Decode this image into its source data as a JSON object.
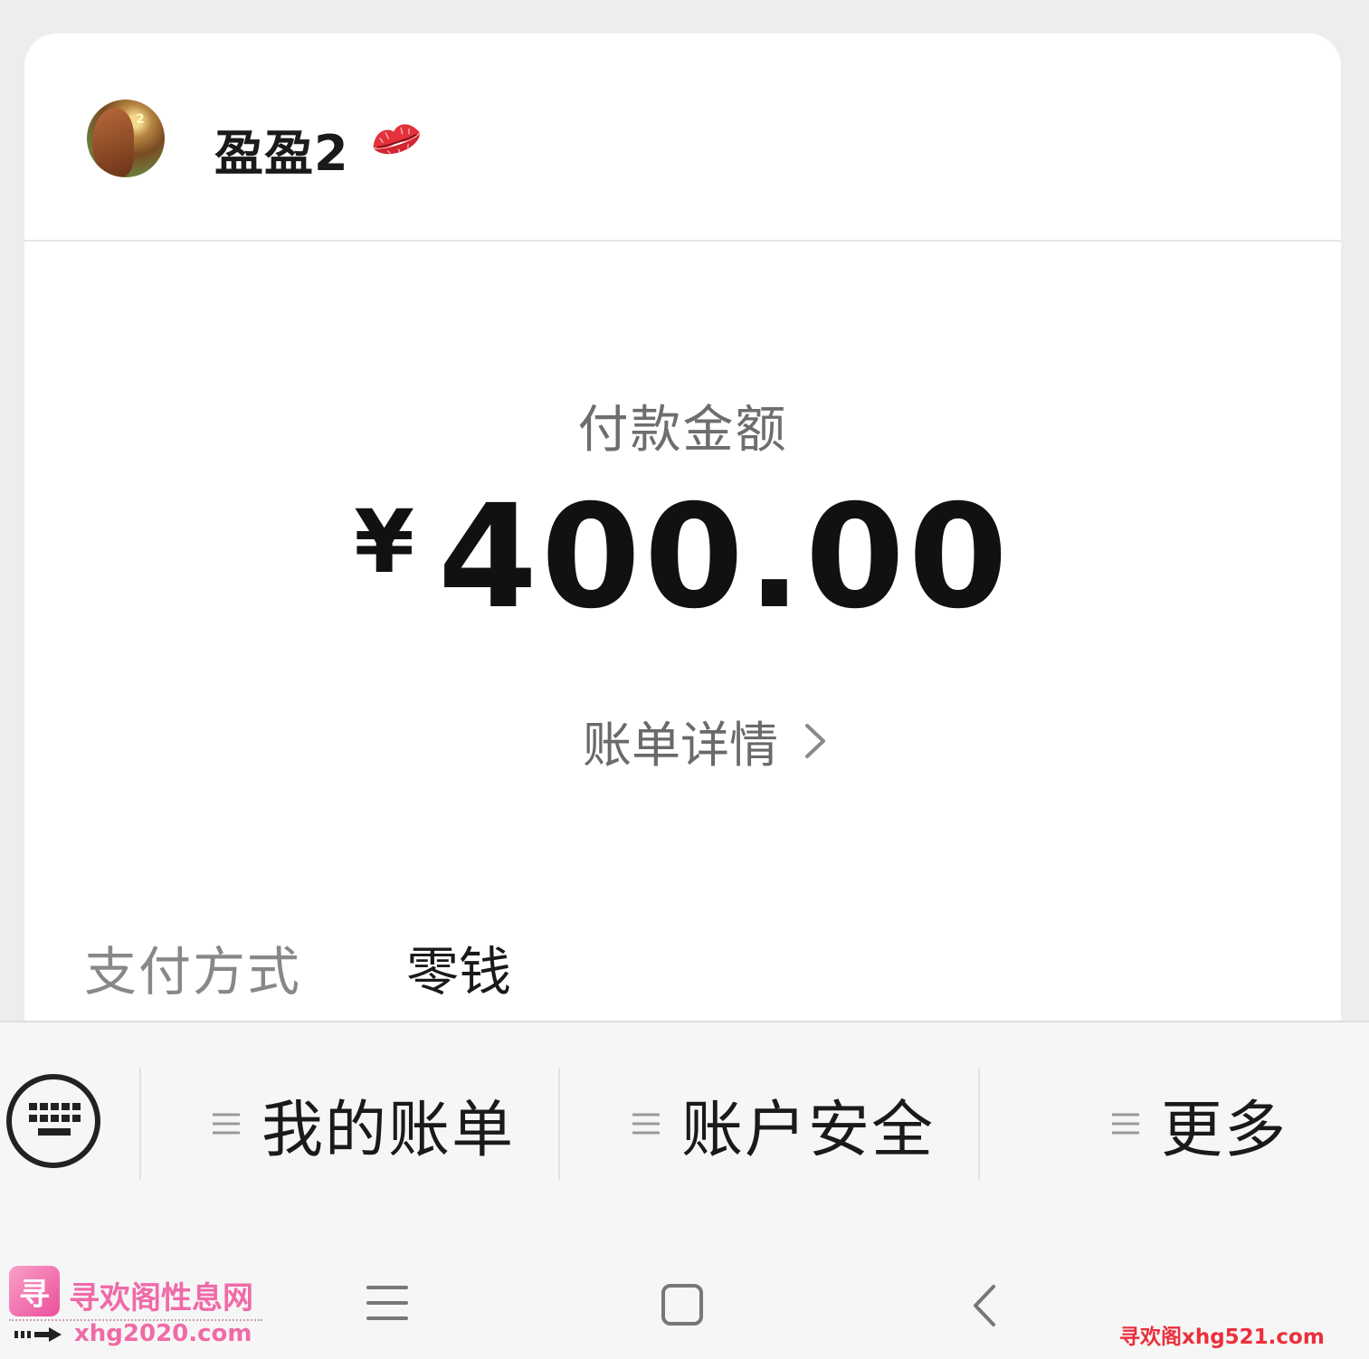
{
  "payee": {
    "name": "盈盈2",
    "avatar_badge": "2",
    "emoji_icon": "kiss-mark-icon"
  },
  "payment": {
    "amount_label": "付款金额",
    "currency_symbol": "¥",
    "amount": "400.00",
    "bill_detail_link": "账单详情"
  },
  "payment_method": {
    "label": "支付方式",
    "value": "零钱"
  },
  "menu_bar": {
    "keyboard_icon": "keyboard-icon",
    "items": [
      {
        "label": "我的账单",
        "icon": "menu-lines-icon"
      },
      {
        "label": "账户安全",
        "icon": "menu-lines-icon"
      },
      {
        "label": "更多",
        "icon": "menu-lines-icon"
      }
    ]
  },
  "system_nav": {
    "buttons": [
      "menu-icon",
      "home-icon",
      "back-icon"
    ]
  },
  "watermarks": {
    "left_logo": "寻",
    "left_title": "寻欢阁性息网",
    "left_url": "xhg2020.com",
    "right_text": "寻欢阁xhg521.com"
  },
  "colors": {
    "background": "#ededed",
    "card": "#ffffff",
    "watermark_pink": "#f06aa8",
    "watermark_red": "#ec2f3c"
  }
}
